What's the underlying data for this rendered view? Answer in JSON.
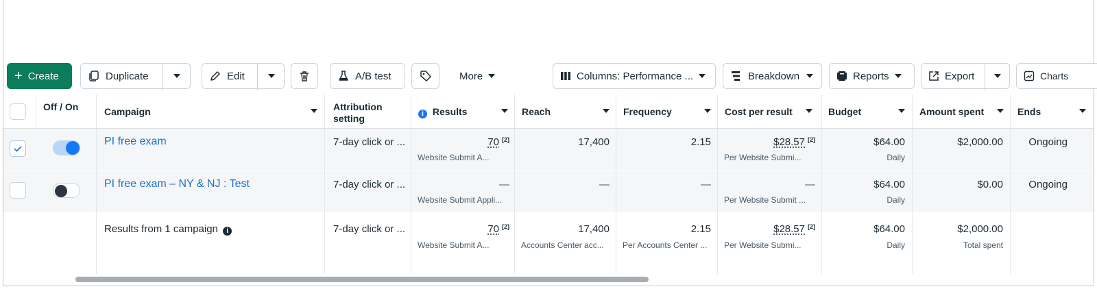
{
  "toolbar": {
    "create": "Create",
    "duplicate": "Duplicate",
    "edit": "Edit",
    "ab_test": "A/B test",
    "more": "More",
    "columns": "Columns: Performance ...",
    "breakdown": "Breakdown",
    "reports": "Reports",
    "export": "Export",
    "charts": "Charts"
  },
  "headers": {
    "off_on": "Off / On",
    "campaign": "Campaign",
    "attribution": "Attribution setting",
    "results": "Results",
    "reach": "Reach",
    "frequency": "Frequency",
    "cost_per_result": "Cost per result",
    "budget": "Budget",
    "amount_spent": "Amount spent",
    "ends": "Ends"
  },
  "rows": [
    {
      "selected": true,
      "on": true,
      "campaign": "PI free exam",
      "attribution": "7-day click or ...",
      "results": "70",
      "results_fn": "[2]",
      "results_sub": "Website Submit A...",
      "reach": "17,400",
      "frequency": "2.15",
      "cost": "$28.57",
      "cost_fn": "[2]",
      "cost_sub": "Per Website Submi...",
      "budget": "$64.00",
      "budget_sub": "Daily",
      "amount": "$2,000.00",
      "ends": "Ongoing"
    },
    {
      "selected": false,
      "on": false,
      "campaign": "PI free exam – NY & NJ : Test",
      "attribution": "7-day click or ...",
      "results": "—",
      "results_sub": "Website Submit Appli...",
      "reach": "—",
      "frequency": "—",
      "cost": "—",
      "cost_sub": "Per Website Submit ...",
      "budget": "$64.00",
      "budget_sub": "Daily",
      "amount": "$0.00",
      "ends": "Ongoing"
    }
  ],
  "total": {
    "label": "Results from 1 campaign",
    "attribution": "7-day click or ...",
    "results": "70",
    "results_fn": "[2]",
    "results_sub": "Website Submit A...",
    "reach": "17,400",
    "reach_sub": "Accounts Center acc...",
    "frequency": "2.15",
    "frequency_sub": "Per Accounts Center ...",
    "cost": "$28.57",
    "cost_fn": "[2]",
    "cost_sub": "Per Website Submi...",
    "budget": "$64.00",
    "budget_sub": "Daily",
    "amount": "$2,000.00",
    "amount_sub": "Total spent"
  },
  "colors": {
    "create_green": "#0a7d5a",
    "link_blue": "#1a6fcf",
    "toggle_blue": "#1877f2"
  },
  "icons": [
    "plus-icon",
    "duplicate-icon",
    "pencil-icon",
    "trash-icon",
    "flask-icon",
    "tag-icon",
    "columns-icon",
    "breakdown-icon",
    "reports-icon",
    "export-icon",
    "charts-icon",
    "info-icon",
    "checkmark-icon"
  ]
}
